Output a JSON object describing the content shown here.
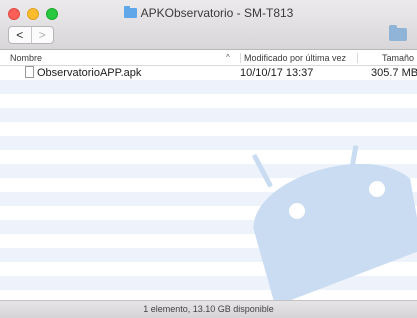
{
  "window": {
    "title": "APKObservatorio - SM-T813"
  },
  "toolbar": {
    "back_label": "<",
    "forward_label": ">"
  },
  "columns": {
    "name": "Nombre",
    "modified": "Modificado por última vez",
    "size": "Tamaño"
  },
  "files": [
    {
      "name": "ObservatorioAPP.apk",
      "modified": "10/10/17 13:37",
      "size": "305.7 MB"
    }
  ],
  "status": {
    "text": "1 elemento, 13.10 GB disponible"
  },
  "colors": {
    "row_stripe": "#eef3fb",
    "android_watermark": "#c9dcf1",
    "folder_accent": "#5fa7e8"
  }
}
